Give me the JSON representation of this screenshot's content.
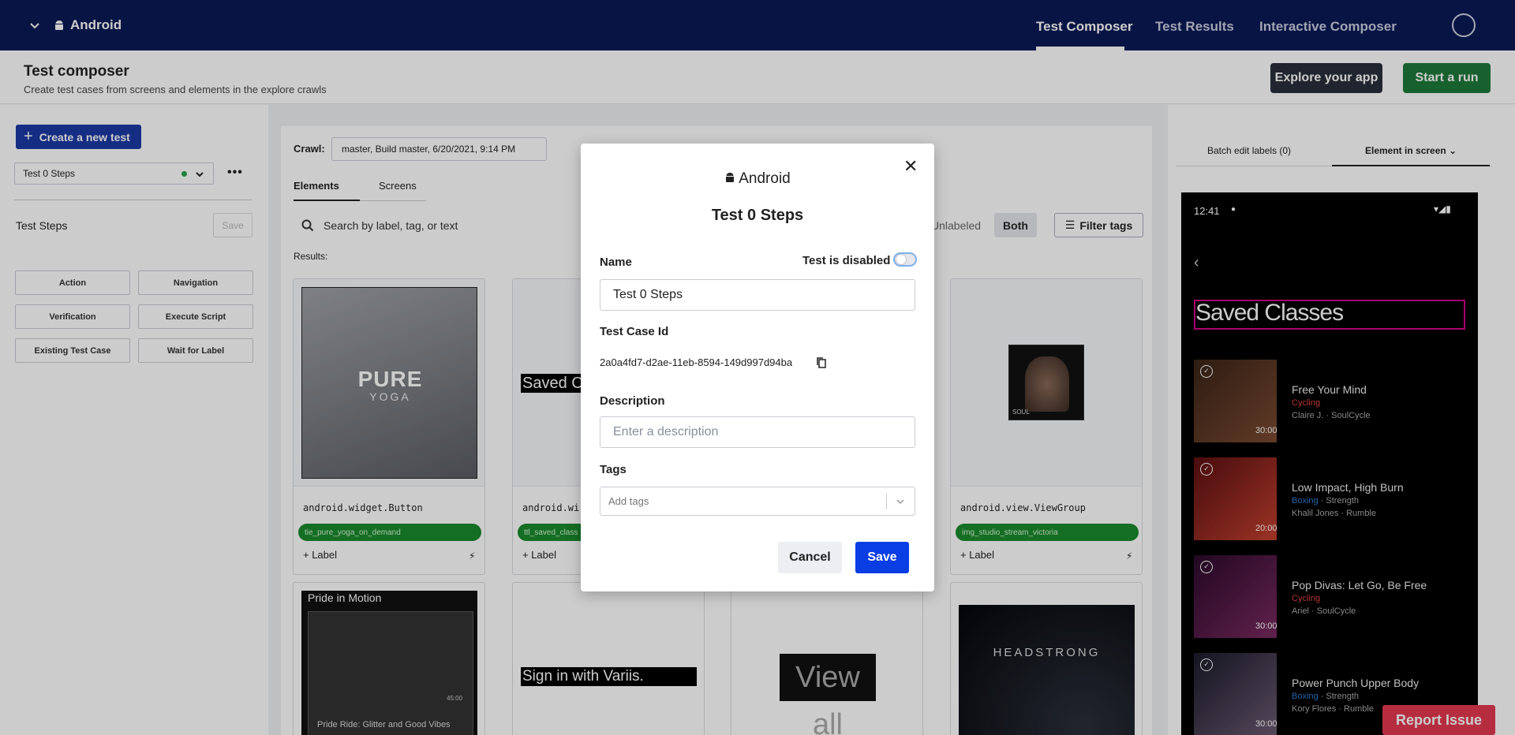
{
  "topnav": {
    "app_name": "Android",
    "links": [
      "Test Composer",
      "Test Results",
      "Interactive Composer"
    ]
  },
  "header": {
    "title": "Test composer",
    "subtitle": "Create test cases from screens and elements in the explore crawls",
    "explore_label": "Explore your app",
    "run_label": "Start a run"
  },
  "left": {
    "create_label": "Create a new test",
    "selected_test": "Test 0 Steps",
    "steps_title": "Test Steps",
    "save_label": "Save",
    "step_buttons": [
      "Action",
      "Navigation",
      "Verification",
      "Execute Script",
      "Existing Test Case",
      "Wait for Label"
    ]
  },
  "center": {
    "crawl_label": "Crawl:",
    "crawl_value": "master, Build master, 6/20/2021, 9:14 PM",
    "tabs": [
      "Elements",
      "Screens"
    ],
    "search_placeholder": "Search by label, tag, or text",
    "unlabeled": "Unlabeled",
    "both": "Both",
    "filter_tags": "Filter tags",
    "results_label": "Results:",
    "cards": [
      {
        "class_name": "android.widget.Button",
        "badge": "tie_pure_yoga_on_demand",
        "add_label": "+ Label",
        "thumb_text": "PURE",
        "thumb_sub": "YOGA"
      },
      {
        "class_name": "android.wi",
        "badge": "ttl_saved_class",
        "add_label": "+ Label",
        "thumb_text": "Saved Cla"
      },
      {
        "class_name": "android.view.ViewGroup",
        "badge": "img_studio_stream_victoria",
        "add_label": "+ Label",
        "thumb_text": "SOUL"
      }
    ],
    "row2": {
      "pride_title": "Pride in Motion",
      "pride_duration": "45:00",
      "pride_caption": "Pride Ride: Glitter and Good Vibes",
      "signin": "Sign in with Variis.",
      "viewall": "View all",
      "headstrong": "HEADSTRONG"
    }
  },
  "right": {
    "tab1": "Batch edit labels (0)",
    "tab2": "Element in screen",
    "phone_time": "12:41",
    "phone_heading": "Saved Classes",
    "items": [
      {
        "title": "Free Your Mind",
        "category": "Cycling",
        "category_color": "#e0443c",
        "extra": "",
        "sub": "Claire J. · SoulCycle",
        "duration": "30:00"
      },
      {
        "title": "Low Impact, High Burn",
        "category": "Boxing",
        "category_color": "#2f7fd6",
        "extra": " · Strength",
        "sub": "Khalil Jones · Rumble",
        "duration": "20:00"
      },
      {
        "title": "Pop Divas: Let Go, Be Free",
        "category": "Cycling",
        "category_color": "#e0443c",
        "extra": "",
        "sub": "Ariel · SoulCycle",
        "duration": "30:00"
      },
      {
        "title": "Power Punch Upper Body",
        "category": "Boxing",
        "category_color": "#2f7fd6",
        "extra": " · Strength",
        "sub": "Kory Flores · Rumble",
        "duration": "30:00"
      }
    ],
    "report_label": "Report Issue"
  },
  "modal": {
    "platform": "Android",
    "title": "Test 0 Steps",
    "name_label": "Name",
    "disabled_label": "Test is disabled",
    "disabled_on": false,
    "name_value": "Test 0 Steps",
    "tcid_label": "Test Case Id",
    "tcid_value": "2a0a4fd7-d2ae-11eb-8594-149d997d94ba",
    "desc_label": "Description",
    "desc_placeholder": "Enter a description",
    "tags_label": "Tags",
    "tags_placeholder": "Add tags",
    "cancel_label": "Cancel",
    "save_label": "Save"
  }
}
